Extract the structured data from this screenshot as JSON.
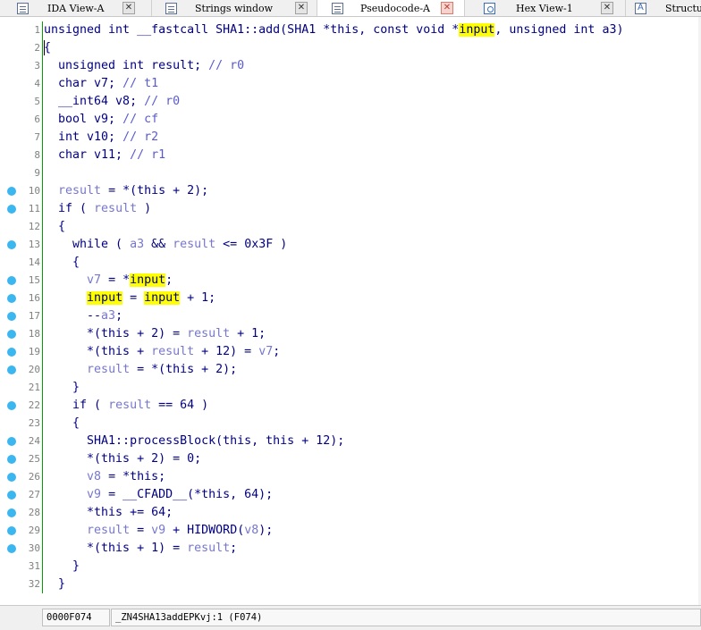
{
  "tabs": [
    {
      "label": "IDA View-A",
      "icon": "listing-icon",
      "active": false
    },
    {
      "label": "Strings window",
      "icon": "listing-icon",
      "active": false
    },
    {
      "label": "Pseudocode-A",
      "icon": "listing-icon",
      "active": true
    },
    {
      "label": "Hex View-1",
      "icon": "hex-icon",
      "active": false
    },
    {
      "label": "Structu",
      "icon": "struct-icon",
      "active": false
    }
  ],
  "code_lines": [
    {
      "n": "1",
      "bp": false,
      "html": "unsigned int __fastcall SHA1::add(SHA1 *this, const void *<span class='hl'>input</span>, unsigned int a3)"
    },
    {
      "n": "2",
      "bp": false,
      "html": "{"
    },
    {
      "n": "3",
      "bp": false,
      "html": "  unsigned int result; <span class='cmt'>// r0</span>"
    },
    {
      "n": "4",
      "bp": false,
      "html": "  char v7; <span class='cmt'>// t1</span>"
    },
    {
      "n": "5",
      "bp": false,
      "html": "  __int64 v8; <span class='cmt'>// r0</span>"
    },
    {
      "n": "6",
      "bp": false,
      "html": "  bool v9; <span class='cmt'>// cf</span>"
    },
    {
      "n": "7",
      "bp": false,
      "html": "  int v10; <span class='cmt'>// r2</span>"
    },
    {
      "n": "8",
      "bp": false,
      "html": "  char v11; <span class='cmt'>// r1</span>"
    },
    {
      "n": "9",
      "bp": false,
      "html": ""
    },
    {
      "n": "10",
      "bp": true,
      "html": "  <span class='var'>result</span> = *(this + 2);"
    },
    {
      "n": "11",
      "bp": true,
      "html": "  if ( <span class='var'>result</span> )"
    },
    {
      "n": "12",
      "bp": false,
      "html": "  {"
    },
    {
      "n": "13",
      "bp": true,
      "html": "    while ( <span class='var'>a3</span> &amp;&amp; <span class='var'>result</span> &lt;= 0x3F )"
    },
    {
      "n": "14",
      "bp": false,
      "html": "    {"
    },
    {
      "n": "15",
      "bp": true,
      "html": "      <span class='var'>v7</span> = *<span class='hl'>input</span>;"
    },
    {
      "n": "16",
      "bp": true,
      "html": "      <span class='hl'>input</span> = <span class='hl'>input</span> + 1;"
    },
    {
      "n": "17",
      "bp": true,
      "html": "      --<span class='var'>a3</span>;"
    },
    {
      "n": "18",
      "bp": true,
      "html": "      *(this + 2) = <span class='var'>result</span> + 1;"
    },
    {
      "n": "19",
      "bp": true,
      "html": "      *(this + <span class='var'>result</span> + 12) = <span class='var'>v7</span>;"
    },
    {
      "n": "20",
      "bp": true,
      "html": "      <span class='var'>result</span> = *(this + 2);"
    },
    {
      "n": "21",
      "bp": false,
      "html": "    }"
    },
    {
      "n": "22",
      "bp": true,
      "html": "    if ( <span class='var'>result</span> == 64 )"
    },
    {
      "n": "23",
      "bp": false,
      "html": "    {"
    },
    {
      "n": "24",
      "bp": true,
      "html": "      SHA1::processBlock(this, this + 12);"
    },
    {
      "n": "25",
      "bp": true,
      "html": "      *(this + 2) = 0;"
    },
    {
      "n": "26",
      "bp": true,
      "html": "      <span class='var'>v8</span> = *this;"
    },
    {
      "n": "27",
      "bp": true,
      "html": "      <span class='var'>v9</span> = __CFADD__(*this, 64);"
    },
    {
      "n": "28",
      "bp": true,
      "html": "      *this += 64;"
    },
    {
      "n": "29",
      "bp": true,
      "html": "      <span class='var'>result</span> = <span class='var'>v9</span> + HIDWORD(<span class='var'>v8</span>);"
    },
    {
      "n": "30",
      "bp": true,
      "html": "      *(this + 1) = <span class='var'>result</span>;"
    },
    {
      "n": "31",
      "bp": false,
      "html": "    }"
    },
    {
      "n": "32",
      "bp": false,
      "html": "  }"
    }
  ],
  "status": {
    "address": "0000F074",
    "location": "_ZN4SHA13addEPKvj:1 (F074)"
  },
  "colors": {
    "code_text": "#000080",
    "local_var": "#7777cc",
    "highlight": "#ffff00",
    "breakpoint_dot": "#3cb6ef",
    "gutter_line": "#00a000"
  }
}
